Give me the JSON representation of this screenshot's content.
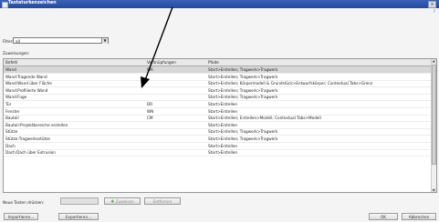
{
  "window": {
    "title": "Tastaturkenzeichen",
    "close_glyph": "x",
    "help_glyph": "?"
  },
  "filter": {
    "label": "Filter:",
    "value": "all",
    "arrow_glyph": "▼"
  },
  "assignments_label": "Zuweisungen:",
  "grid": {
    "columns": [
      "Befehl",
      "Verknüpfungen",
      "Pfade"
    ],
    "selected_row": 0,
    "rows": [
      [
        "Wand",
        "WA",
        "Start>Erstellen; Tragwerk>Tragwerk"
      ],
      [
        "Wand:Tragende Wand",
        "",
        "Start>Erstellen; Tragwerk>Tragwerk"
      ],
      [
        "Wand:Wand über Fläche",
        "",
        "Start>Erstellen; Körpermodell & Grundstück>Entwurfskörper; Contextual Tabs>Grenz"
      ],
      [
        "Wand:Profilierte Wand",
        "",
        "Start>Erstellen; Tragwerk>Tragwerk"
      ],
      [
        "Wand:Fuge",
        "",
        "Start>Erstellen; Tragwerk>Tragwerk"
      ],
      [
        "Tür",
        "DR",
        "Start>Erstellen"
      ],
      [
        "Fenster",
        "WN",
        "Start>Erstellen"
      ],
      [
        "Bauteil",
        "CM",
        "Start>Erstellen; Erstellen>Modell; Contextual Tabs>Modell"
      ],
      [
        "Bauteil:Projektbereiche erstellen",
        "",
        "Start>Erstellen"
      ],
      [
        "Stütze",
        "",
        "Start>Erstellen; Tragwerk>Tragwerk"
      ],
      [
        "Stütze:Tragwerksstütze",
        "",
        "Start>Erstellen; Tragwerk>Tragwerk"
      ],
      [
        "Dach",
        "",
        "Start>Erstellen"
      ],
      [
        "Dach:Dach über Extrusion",
        "",
        "Start>Erstellen"
      ]
    ]
  },
  "new_keys": {
    "label": "Neue Tasten drücken:",
    "value": ""
  },
  "buttons": {
    "assign": "Zuweisen",
    "assign_icon": "✚",
    "remove": "Entfernen",
    "import": "Importieren...",
    "export": "Exportieren...",
    "ok": "OK",
    "cancel": "Abbrechen"
  }
}
